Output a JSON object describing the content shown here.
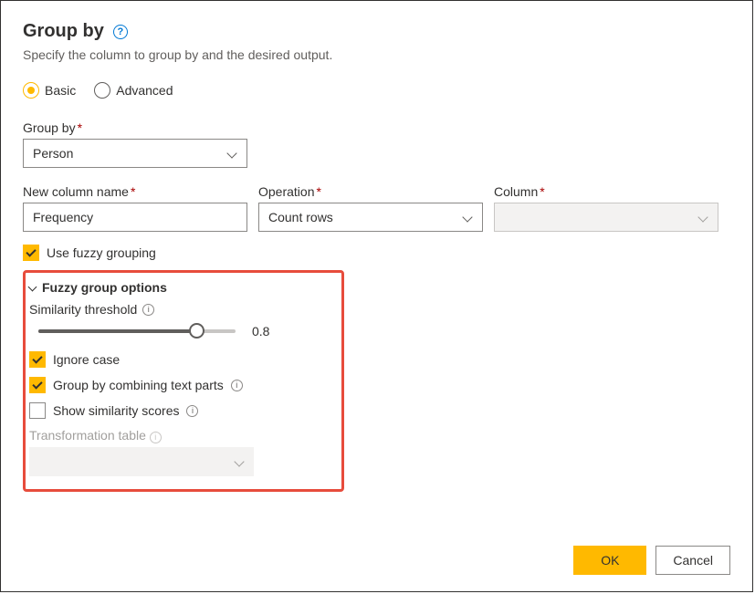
{
  "header": {
    "title": "Group by",
    "help_icon": "?",
    "subtitle": "Specify the column to group by and the desired output."
  },
  "mode": {
    "basic_label": "Basic",
    "advanced_label": "Advanced",
    "selected": "basic"
  },
  "group_by": {
    "label": "Group by",
    "value": "Person"
  },
  "new_column": {
    "label": "New column name",
    "value": "Frequency"
  },
  "operation": {
    "label": "Operation",
    "value": "Count rows"
  },
  "column": {
    "label": "Column",
    "value": ""
  },
  "fuzzy_grouping": {
    "label": "Use fuzzy grouping",
    "checked": true
  },
  "fuzzy_options": {
    "title": "Fuzzy group options",
    "similarity": {
      "label": "Similarity threshold",
      "value": "0.8",
      "percent": 80
    },
    "ignore_case": {
      "label": "Ignore case",
      "checked": true
    },
    "combine_text": {
      "label": "Group by combining text parts",
      "checked": true
    },
    "show_scores": {
      "label": "Show similarity scores",
      "checked": false
    },
    "transform_table": {
      "label": "Transformation table",
      "value": ""
    }
  },
  "footer": {
    "ok": "OK",
    "cancel": "Cancel"
  }
}
